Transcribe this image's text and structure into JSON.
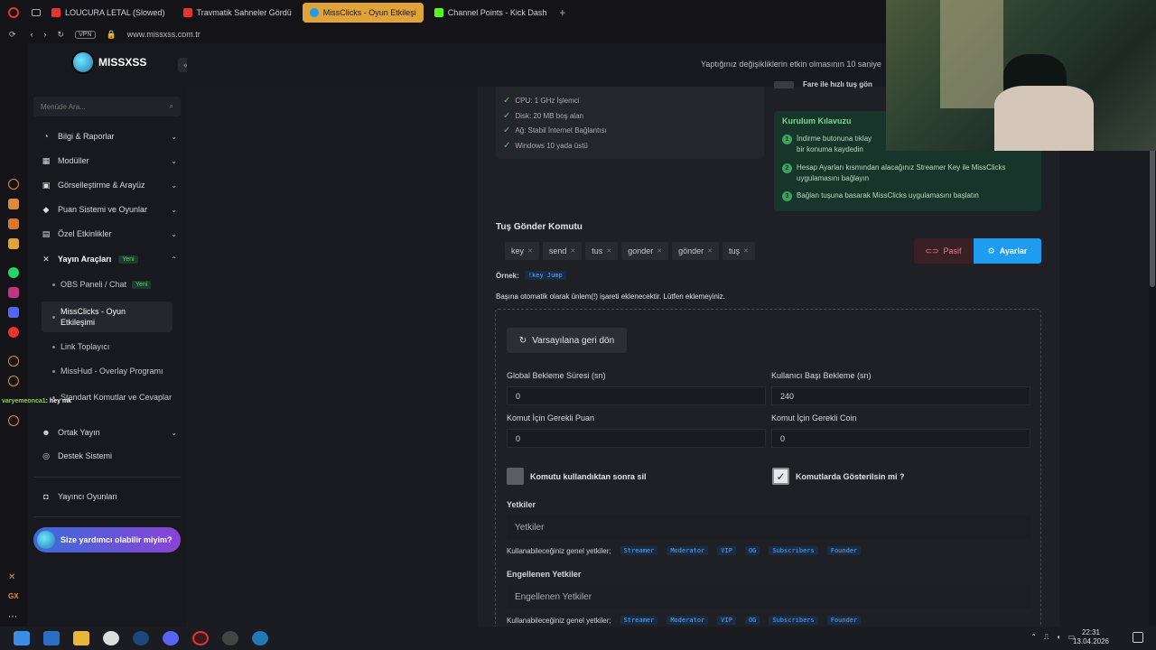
{
  "tabs": [
    {
      "label": "LOUCURA LETAL (Slowed)",
      "color": "#e8332f",
      "active": false
    },
    {
      "label": "Travmatik Sahneler Gördü",
      "color": "#e8332f",
      "active": false
    },
    {
      "label": "MissClicks - Oyun Etkileşi",
      "color": "#1d9cf0",
      "active": true
    },
    {
      "label": "Channel Points - Kick Dash",
      "color": "#53fc18",
      "active": false
    }
  ],
  "address": {
    "vpn": "VPN",
    "url": "www.missxss.com.tr"
  },
  "brand": {
    "name": "MISSXSS"
  },
  "sidebar": {
    "search_placeholder": "Menüde Ara...",
    "items": [
      {
        "label": "Bilgi & Raporlar",
        "icon": "dashboard-icon"
      },
      {
        "label": "Modüller",
        "icon": "grid-icon"
      },
      {
        "label": "Görselleştirme & Arayüz",
        "icon": "palette-icon"
      },
      {
        "label": "Puan Sistemi ve Oyunlar",
        "icon": "gamepad-icon"
      },
      {
        "label": "Özel Etkinlikler",
        "icon": "calendar-icon"
      },
      {
        "label": "Yayın Araçları",
        "icon": "tools-icon",
        "badge": "Yeni"
      }
    ],
    "subitems": [
      {
        "label": "OBS Paneli / Chat",
        "badge": "Yeni"
      },
      {
        "label": "MissClicks - Oyun Etkileşimi"
      },
      {
        "label": "Link Toplayıcı"
      },
      {
        "label": "MissHud - Overlay Programı"
      },
      {
        "label": "Standart Komutlar ve Cevaplar"
      }
    ],
    "items2": [
      {
        "label": "Ortak Yayın",
        "icon": "users-icon"
      },
      {
        "label": "Destek Sistemi",
        "icon": "support-icon"
      },
      {
        "label": "Yayıncı Oyunları",
        "icon": "controller-icon"
      }
    ],
    "help": "Size yardımcı olabilir miyim?"
  },
  "notice": "Yaptığınız değişikliklerin etkin olmasının 10 saniye",
  "requirements": [
    "CPU: 1 GHz İşlemci",
    "Disk: 20 MB boş alan",
    "Ağ: Stabil İnternet Bağlantısı",
    "Windows 10 yada üstü"
  ],
  "guide": {
    "check_label": "Fare ile hızlı tuş gön",
    "title": "Kurulum Kılavuzu",
    "steps": [
      {
        "n": "1",
        "text": "İndirme butonuna tıklay\nbir konuma kaydedin"
      },
      {
        "n": "2",
        "text": "Hesap Ayarları kısmından alacağınız Streamer Key ile MissClicks\nuygulamasını bağlayın"
      },
      {
        "n": "3",
        "text": "Bağlan tuşuna basarak MissClicks uygulamasını başlatın"
      }
    ]
  },
  "command": {
    "title": "Tuş Gönder Komutu",
    "aliases": [
      "key",
      "send",
      "tus",
      "gonder",
      "gönder",
      "tuş"
    ],
    "pasif": "Pasif",
    "ayarlar": "Ayarlar",
    "example_label": "Örnek:",
    "example_code": "!key Jump",
    "warning": "Başına otomatik olarak ünlem(!) işareti eklenecektir. Lütfen eklemeyiniz.",
    "reset": "Varsayılana geri dön",
    "global_cd_label": "Global Bekleme Süresi (sn)",
    "global_cd": "0",
    "user_cd_label": "Kullanıcı Başı Bekleme (sn)",
    "user_cd": "240",
    "points_label": "Komut İçin Gerekli Puan",
    "points": "0",
    "coin_label": "Komut İçin Gerekli Coin",
    "coin": "0",
    "delete_label": "Komutu kullandıktan sonra sil",
    "show_label": "Komutlarda Gösterilsin mi ?",
    "perms_label": "Yetkiler",
    "perms_placeholder": "Yetkiler",
    "available_label": "Kullanabileceğiniz genel yetkiler;",
    "roles": [
      "Streamer",
      "Moderator",
      "VIP",
      "OG",
      "Subscribers",
      "Founder"
    ],
    "blocked_label": "Engellenen Yetkiler",
    "blocked_placeholder": "Engellenen Yetkiler"
  },
  "chat": {
    "user": "varyemeonca1",
    "msg": ": hey mk"
  },
  "clock": {
    "time": "22:31",
    "date": "13.04.2026"
  }
}
